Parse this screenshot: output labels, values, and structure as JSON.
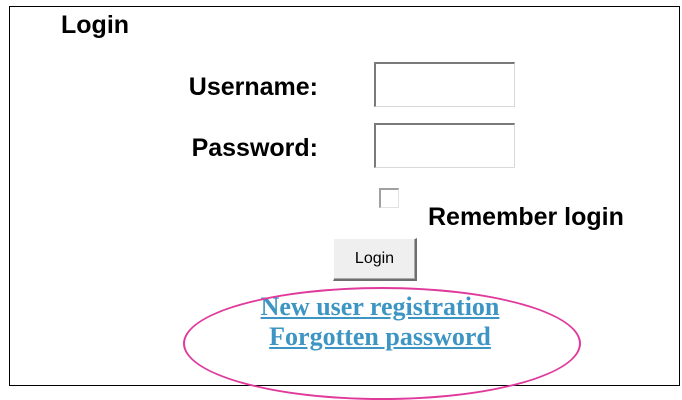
{
  "form": {
    "title": "Login",
    "username_label": "Username:",
    "username_value": "",
    "password_label": "Password:",
    "password_value": "",
    "remember_label": "Remember login",
    "remember_checked": false,
    "submit_label": "Login"
  },
  "links": {
    "register": "New user registration",
    "forgot": "Forgotten password"
  },
  "colors": {
    "link": "#3d95c4",
    "highlight_ellipse": "#e0399c"
  }
}
